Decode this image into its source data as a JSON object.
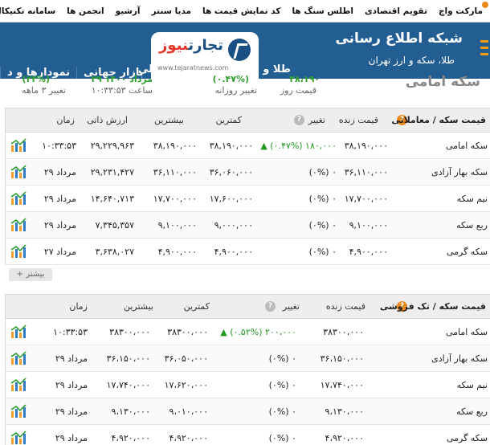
{
  "topnav": {
    "items": [
      "مارکت واچ",
      "تقویم اقتصادی",
      "اطلس سنگ ها",
      "کد نمایش قیمت ها",
      "مدیا سنتر",
      "آرشیو",
      "انجمن ها",
      "سامانه تکنیکال"
    ]
  },
  "header": {
    "brand_title": "شبکه اطلاع رسانی",
    "brand_subtitle": "طلا، سکه و ارز تهران",
    "logo_text_a": "تجارت",
    "logo_text_b": "نیوز",
    "logo_url": "www.tejaratnews.com",
    "nav_right": "طلا و",
    "nav_logo_side": "لی",
    "nav": [
      "بازار جهانی",
      "نمودارها و د"
    ]
  },
  "summary": {
    "page_title": "سکه امامی",
    "daily_price_label": "قیمت روز",
    "daily_change_label": "تغییر روزانه",
    "time_label": "ساعت ۱۰:۳۳:۵۳",
    "three_month_label": "تغییر ۳ ماهه",
    "v1": "۳۸،۱۹۰",
    "v2": "(۰.۴۷%)",
    "v3": "۲۹ مرداد ۱۴۰۰",
    "v4": "(۲۴%)"
  },
  "trade_table": {
    "title": "قیمت سکه / معاملاتی",
    "headers": {
      "live": "قیمت زنده",
      "change": "تغییر",
      "min": "کمترین",
      "max": "بیشترین",
      "intrinsic": "ارزش ذاتی",
      "time": "زمان"
    },
    "rows": [
      {
        "name": "سکه امامی",
        "live": "۳۸,۱۹۰,۰۰۰",
        "change": "▲ (۰.۴۷%) ۱۸۰,۰۰۰",
        "up": true,
        "min": "۳۸,۱۹۰,۰۰۰",
        "max": "۳۸,۱۹۰,۰۰۰",
        "intrinsic": "۲۹,۲۲۹,۹۶۳",
        "time": "۱۰:۳۳:۵۳"
      },
      {
        "name": "سکه بهار آزادی",
        "live": "۳۶,۱۱۰,۰۰۰",
        "change": "(۰%) ۰",
        "up": false,
        "min": "۳۶,۰۶۰,۰۰۰",
        "max": "۳۶,۱۱۰,۰۰۰",
        "intrinsic": "۲۹,۲۳۱,۴۲۷",
        "time": "۲۹ مرداد"
      },
      {
        "name": "نیم سکه",
        "live": "۱۷,۷۰۰,۰۰۰",
        "change": "(۰%) ۰",
        "up": false,
        "min": "۱۷,۶۰۰,۰۰۰",
        "max": "۱۷,۷۰۰,۰۰۰",
        "intrinsic": "۱۴,۶۴۰,۷۱۳",
        "time": "۲۹ مرداد"
      },
      {
        "name": "ربع سکه",
        "live": "۹,۱۰۰,۰۰۰",
        "change": "(۰%) ۰",
        "up": false,
        "min": "۹,۰۰۰,۰۰۰",
        "max": "۹,۱۰۰,۰۰۰",
        "intrinsic": "۷,۳۴۵,۳۵۷",
        "time": "۲۹ مرداد"
      },
      {
        "name": "سکه گرمی",
        "live": "۴,۹۰۰,۰۰۰",
        "change": "(۰%) ۰",
        "up": false,
        "min": "۴,۹۰۰,۰۰۰",
        "max": "۴,۹۰۰,۰۰۰",
        "intrinsic": "۳,۶۳۸,۰۲۷",
        "time": "۲۷ مرداد"
      }
    ],
    "more_label": "+ بیشتر"
  },
  "retail_table": {
    "title": "قیمت سکه / تک فروشی",
    "headers": {
      "live": "قیمت زنده",
      "change": "تغییر",
      "min": "کمترین",
      "max": "بیشترین",
      "time": "زمان"
    },
    "rows": [
      {
        "name": "سکه امامی",
        "live": "۳۸۳۰۰،۰۰۰",
        "change": "▲ (۰.۵۲%) ۲۰۰،۰۰۰",
        "up": true,
        "min": "۳۸۳۰۰،۰۰۰",
        "max": "۳۸۳۰۰،۰۰۰",
        "time": "۱۰:۳۳:۵۳"
      },
      {
        "name": "سکه بهار آزادی",
        "live": "۳۶،۱۵۰،۰۰۰",
        "change": "(۰%) ۰",
        "up": false,
        "min": "۳۶،۰۵۰،۰۰۰",
        "max": "۳۶،۱۵۰،۰۰۰",
        "time": "۲۹ مرداد"
      },
      {
        "name": "نیم سکه",
        "live": "۱۷،۷۴۰،۰۰۰",
        "change": "(۰%) ۰",
        "up": false,
        "min": "۱۷،۶۲۰،۰۰۰",
        "max": "۱۷،۷۴۰،۰۰۰",
        "time": "۲۹ مرداد"
      },
      {
        "name": "ربع سکه",
        "live": "۹،۱۳۰،۰۰۰",
        "change": "(۰%) ۰",
        "up": false,
        "min": "۹،۰۱۰،۰۰۰",
        "max": "۹،۱۳۰،۰۰۰",
        "time": "۲۹ مرداد"
      },
      {
        "name": "سکه گرمی",
        "live": "۴،۹۲۰،۰۰۰",
        "change": "(۰%) ۰",
        "up": false,
        "min": "۴،۹۲۰،۰۰۰",
        "max": "۴،۹۲۰،۰۰۰",
        "time": "۲۹ مرداد"
      }
    ]
  },
  "colors": {
    "header_bg": "#235e93",
    "accent_orange": "#e8891a",
    "up_green": "#1f9a1f"
  }
}
